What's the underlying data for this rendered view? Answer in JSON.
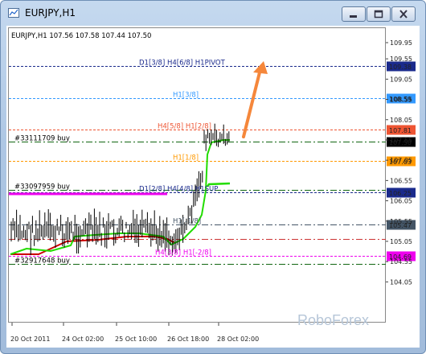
{
  "window": {
    "title": "EURJPY,H1",
    "buttons": [
      "minimize",
      "maximize",
      "close"
    ],
    "icon": "chart-window-icon"
  },
  "chart": {
    "header": "EURJPY,H1  107.56 107.58 107.44 107.50",
    "watermark": "RoboForex",
    "colors": {
      "background": "#ffffff",
      "candle": "#000000",
      "ma_red": "#cc0000",
      "ma_green": "#22dd00",
      "magenta": "#ee00ee",
      "arrow": "#f5873b"
    },
    "levels": [
      {
        "price": 109.38,
        "label": "D1[3/8] H4[6/8] H1PIVOT",
        "color": "#1a2a8c",
        "dash": "3,2",
        "badge_bg": "#1a2a8c",
        "badge_fg": "#ffffff"
      },
      {
        "price": 108.59,
        "label": "H1[3/8]",
        "color": "#3399ff",
        "dash": "3,2",
        "badge_bg": "#3399ff",
        "badge_fg": "#ffffff"
      },
      {
        "price": 107.81,
        "label": "H4[5/8] H1[2/8]",
        "color": "#ee5533",
        "dash": "3,2",
        "badge_bg": "#ee5533",
        "badge_fg": "#ffffff"
      },
      {
        "price": 107.5,
        "label": "#33111709 buy",
        "color": "#116611",
        "dash": "8,3,2,3",
        "badge_bg": "#000000",
        "badge_fg": "#ffffff"
      },
      {
        "price": 107.03,
        "label": "H1[1/8]",
        "color": "#ff9900",
        "dash": "3,2",
        "badge_bg": "#ff9900",
        "badge_fg": "#ffffff"
      },
      {
        "price": 106.25,
        "label": "D1[2/8] H4[4/8] H1SUP",
        "color": "#1a2a8c",
        "dash": "3,2",
        "badge_bg": "#1a2a8c",
        "badge_fg": "#ffffff"
      },
      {
        "price": 106.31,
        "label": "#33097959 buy",
        "color": "#116611",
        "dash": "8,3,2,3",
        "badge_bg": "",
        "badge_fg": ""
      },
      {
        "price": 105.47,
        "label": "H1[-1/8]",
        "color": "#445566",
        "dash": "8,3,2,3",
        "badge_bg": "#445566",
        "badge_fg": "#ffffff"
      },
      {
        "price": 105.1,
        "label": "",
        "color": "#cc3333",
        "dash": "8,3,2,3",
        "badge_bg": "",
        "badge_fg": ""
      },
      {
        "price": 104.69,
        "label": "H4[3/8] H1[-2/8]",
        "color": "#ee00ee",
        "dash": "3,2",
        "badge_bg": "#ee00ee",
        "badge_fg": "#ffffff"
      },
      {
        "price": 104.5,
        "label": "#32917648 buy",
        "color": "#116611",
        "dash": "8,3,2,3",
        "badge_bg": "",
        "badge_fg": ""
      }
    ],
    "y_ticks": [
      "109.95",
      "109.55",
      "109.05",
      "108.55",
      "108.05",
      "107.55",
      "107.05",
      "106.55",
      "106.05",
      "105.55",
      "105.05",
      "104.55",
      "104.05"
    ],
    "x_ticks": [
      "20 Oct 2011",
      "24 Oct 02:00",
      "25 Oct 10:00",
      "26 Oct 18:00",
      "28 Oct 02:00"
    ]
  }
}
